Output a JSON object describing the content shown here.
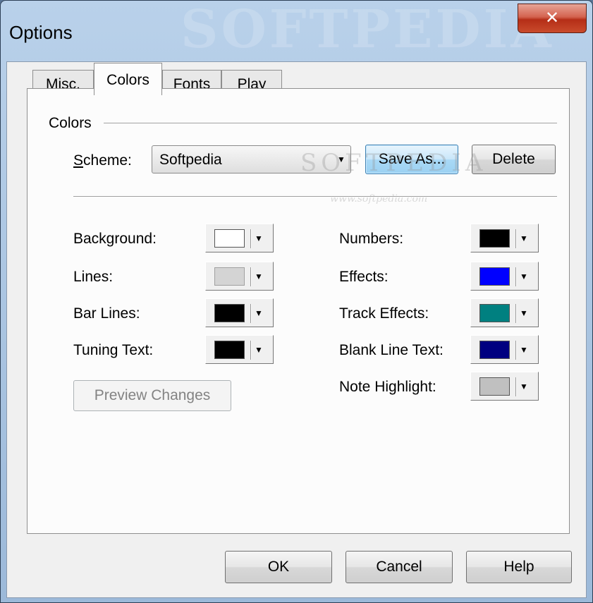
{
  "window": {
    "title": "Options",
    "watermark": "SOFTPEDIA",
    "close_glyph": "✕"
  },
  "tabs": [
    {
      "label": "Misc.",
      "active": false
    },
    {
      "label": "Colors",
      "active": true
    },
    {
      "label": "Fonts",
      "active": false
    },
    {
      "label": "Play",
      "active": false
    }
  ],
  "colors_group": {
    "label": "Colors",
    "scheme_label_accel": "S",
    "scheme_label_rest": "cheme:",
    "scheme_value": "Softpedia",
    "save_as_label": "Save As...",
    "delete_label": "Delete",
    "watermark_small": "www.softpedia.com",
    "watermark_big": "SOFTPEDIA"
  },
  "left_items": [
    {
      "label": "Background:",
      "color": "#ffffff",
      "enabled": true
    },
    {
      "label": "Lines:",
      "color": "#d4d4d4",
      "enabled": false
    },
    {
      "label": "Bar Lines:",
      "color": "#000000",
      "enabled": true
    },
    {
      "label": "Tuning Text:",
      "color": "#000000",
      "enabled": true
    }
  ],
  "right_items": [
    {
      "label": "Numbers:",
      "color": "#000000"
    },
    {
      "label": "Effects:",
      "color": "#0000ff"
    },
    {
      "label": "Track Effects:",
      "color": "#008080"
    },
    {
      "label": "Blank Line Text:",
      "color": "#000080"
    },
    {
      "label": "Note Highlight:",
      "color": "#c0c0c0"
    }
  ],
  "preview_label": "Preview Changes",
  "footer": {
    "ok": "OK",
    "cancel": "Cancel",
    "help": "Help"
  }
}
